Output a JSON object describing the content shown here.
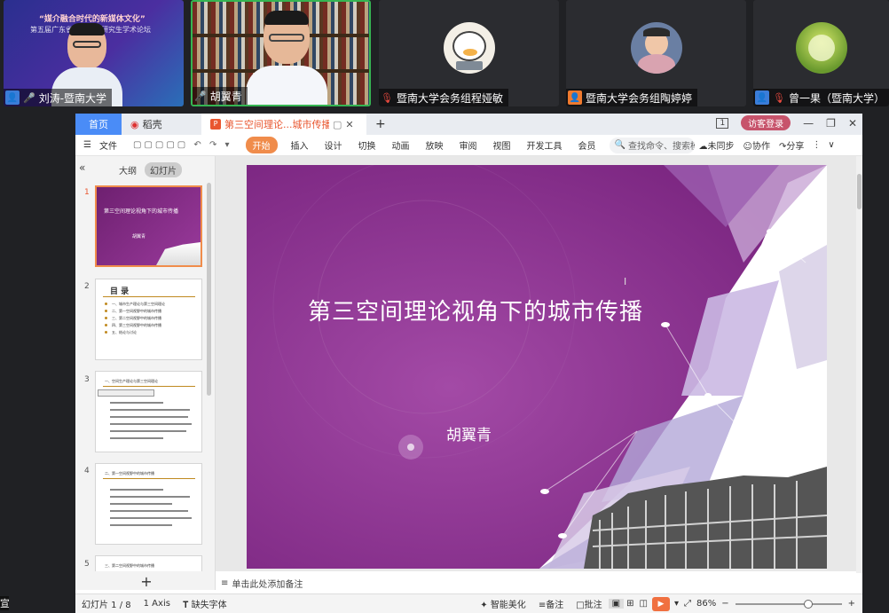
{
  "meeting": {
    "participants": [
      {
        "name": "刘涛-暨南大学",
        "mic": "on",
        "banner_line1": "“媒介融合时代的新媒体文化”",
        "banner_line2": "第五届广东省新闻传播研究生学术论坛"
      },
      {
        "name": "胡翼青",
        "mic": "on"
      },
      {
        "name": "暨南大学会务组程娅敏",
        "mic": "muted"
      },
      {
        "name": "暨南大学会务组陶婷婷",
        "mic": "none"
      },
      {
        "name": "曾一果（暨南大学）",
        "mic": "muted"
      }
    ],
    "edge_char": "宣"
  },
  "app": {
    "tabs": {
      "home": "首页",
      "docer": "稻壳",
      "doc": "第三空间理论...城市传播研究"
    },
    "window": {
      "page_icon": "1",
      "login": "访客登录"
    },
    "menu": [
      "文件",
      "开始",
      "插入",
      "设计",
      "切换",
      "动画",
      "放映",
      "审阅",
      "视图",
      "开发工具",
      "会员"
    ],
    "search_placeholder": "查找命令、搜索模板",
    "right_actions": [
      "未同步",
      "协作",
      "分享"
    ],
    "panel_tabs": {
      "outline": "大纲",
      "slides": "幻灯片"
    },
    "thumbs": [
      {
        "num": "1",
        "title": "第三空间理论视角下的城市传播",
        "author": "胡翼青"
      },
      {
        "num": "2",
        "title": "目  录",
        "items": [
          "一、城市生产理论与第三空间理论",
          "二、第一空间视野中的城市传播",
          "三、第二空间视野中的城市传播",
          "四、第三空间视野中的城市传播",
          "五、结论与讨论"
        ]
      },
      {
        "num": "3",
        "title": "一、空间生产理论与第三空间理论"
      },
      {
        "num": "4",
        "title": "二、第一空间视野中的城市传播"
      },
      {
        "num": "5",
        "title": "三、第二空间视野中的城市传播"
      }
    ],
    "add_slide": "+",
    "slide": {
      "title": "第三空间理论视角下的城市传播",
      "author": "胡翼青"
    },
    "notes_placeholder": "单击此处添加备注",
    "status": {
      "slide_count": "幻灯片 1 / 8",
      "theme": "1 Axis",
      "missing_font": "缺失字体",
      "smart": "智能美化",
      "notes": "备注",
      "comments": "批注",
      "zoom": "86%",
      "zoom_fraction": 0.7
    }
  }
}
